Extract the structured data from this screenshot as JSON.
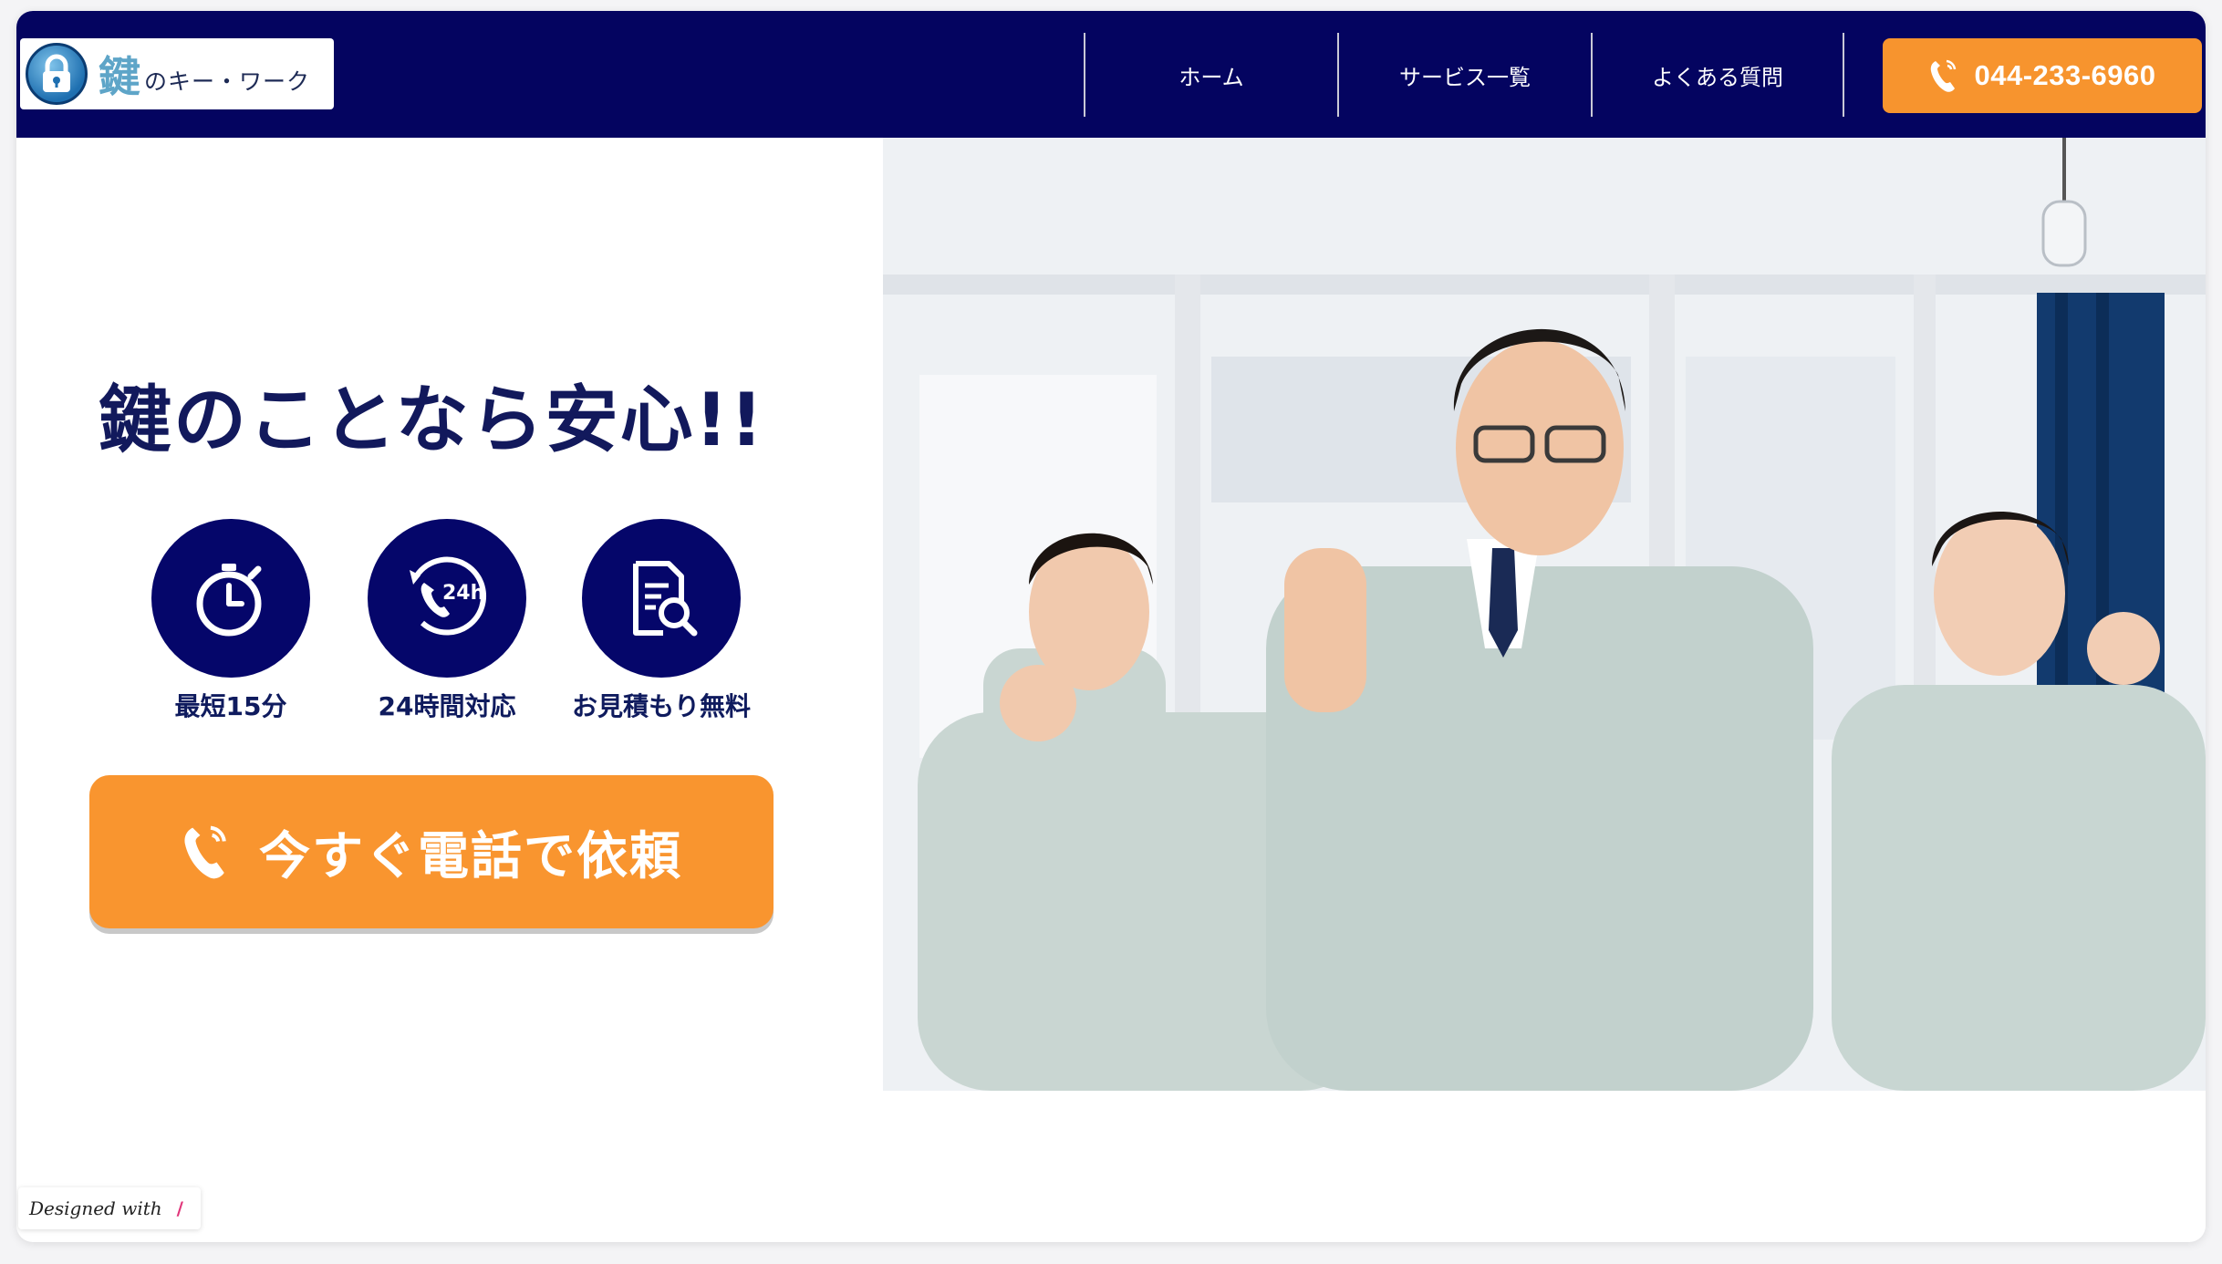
{
  "header": {
    "logo": {
      "kanji": "鍵",
      "kana": "のキー・ワーク"
    },
    "nav": [
      {
        "label": "ホーム"
      },
      {
        "label": "サービス一覧"
      },
      {
        "label": "よくある質問"
      }
    ],
    "phone": "044-233-6960"
  },
  "hero": {
    "headline": "鍵のことなら安心!!",
    "features": [
      {
        "label": "最短15分",
        "icon": "stopwatch-icon"
      },
      {
        "label": "24時間対応",
        "icon": "phone-24h-icon"
      },
      {
        "label": "お見積もり無料",
        "icon": "document-search-icon"
      }
    ],
    "cta_label": "今すぐ電話で依頼"
  },
  "badge": {
    "text": "Designed with",
    "mark": "/"
  },
  "colors": {
    "navy": "#040460",
    "orange": "#f7942e",
    "headline": "#12195c"
  }
}
